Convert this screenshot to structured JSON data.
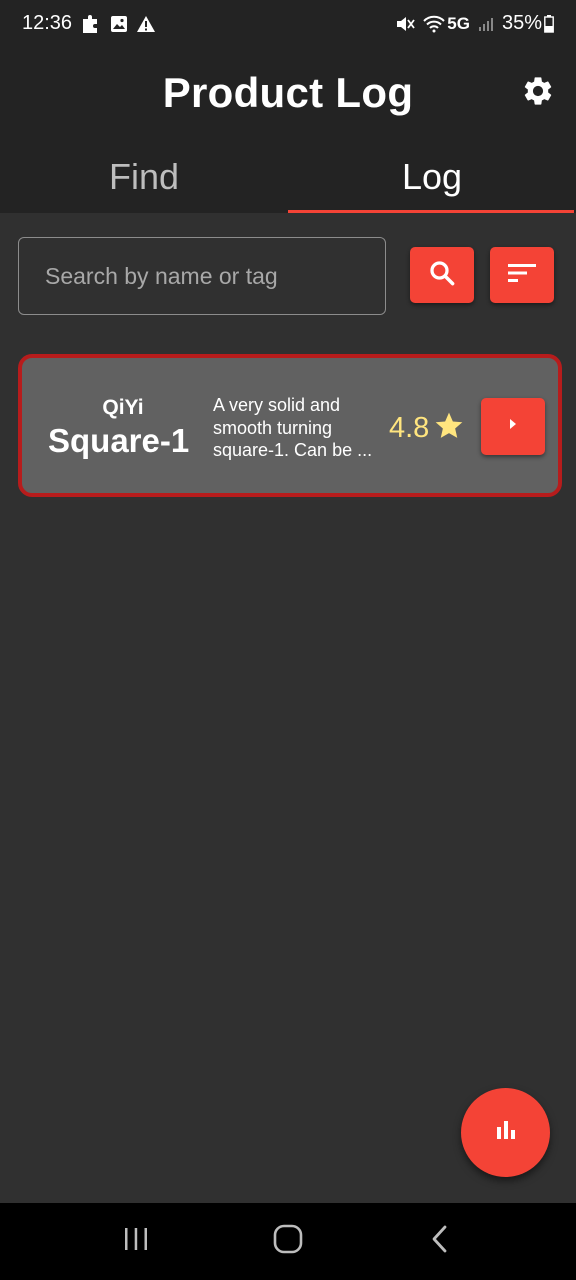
{
  "status_bar": {
    "time": "12:36",
    "network": "5G",
    "battery": "35%",
    "icons": [
      "puzzle-icon",
      "image-icon",
      "warning-icon",
      "mute-icon",
      "wifi-icon",
      "signal-icon",
      "battery-icon"
    ]
  },
  "app_bar": {
    "title": "Product Log",
    "settings_icon": "gear-icon"
  },
  "tabs": [
    {
      "label": "Find",
      "active": false
    },
    {
      "label": "Log",
      "active": true
    }
  ],
  "search": {
    "placeholder": "Search by name or tag",
    "value": "",
    "search_icon": "search-icon",
    "sort_icon": "sort-icon"
  },
  "products": [
    {
      "brand": "QiYi",
      "name": "Square-1",
      "description": "A very solid and smooth turning square-1. Can be ...",
      "rating": "4.8",
      "rating_icon": "star-icon",
      "open_icon": "play-arrow-icon"
    }
  ],
  "fab": {
    "icon": "bar-chart-icon"
  },
  "nav_bar": {
    "icons": [
      "recent-apps-icon",
      "home-icon",
      "back-icon"
    ]
  },
  "colors": {
    "accent": "#f44336",
    "card_border": "#b71c1c",
    "card_background": "#616161",
    "background": "#303030",
    "app_bar": "#232323",
    "rating": "#ffe57f"
  }
}
